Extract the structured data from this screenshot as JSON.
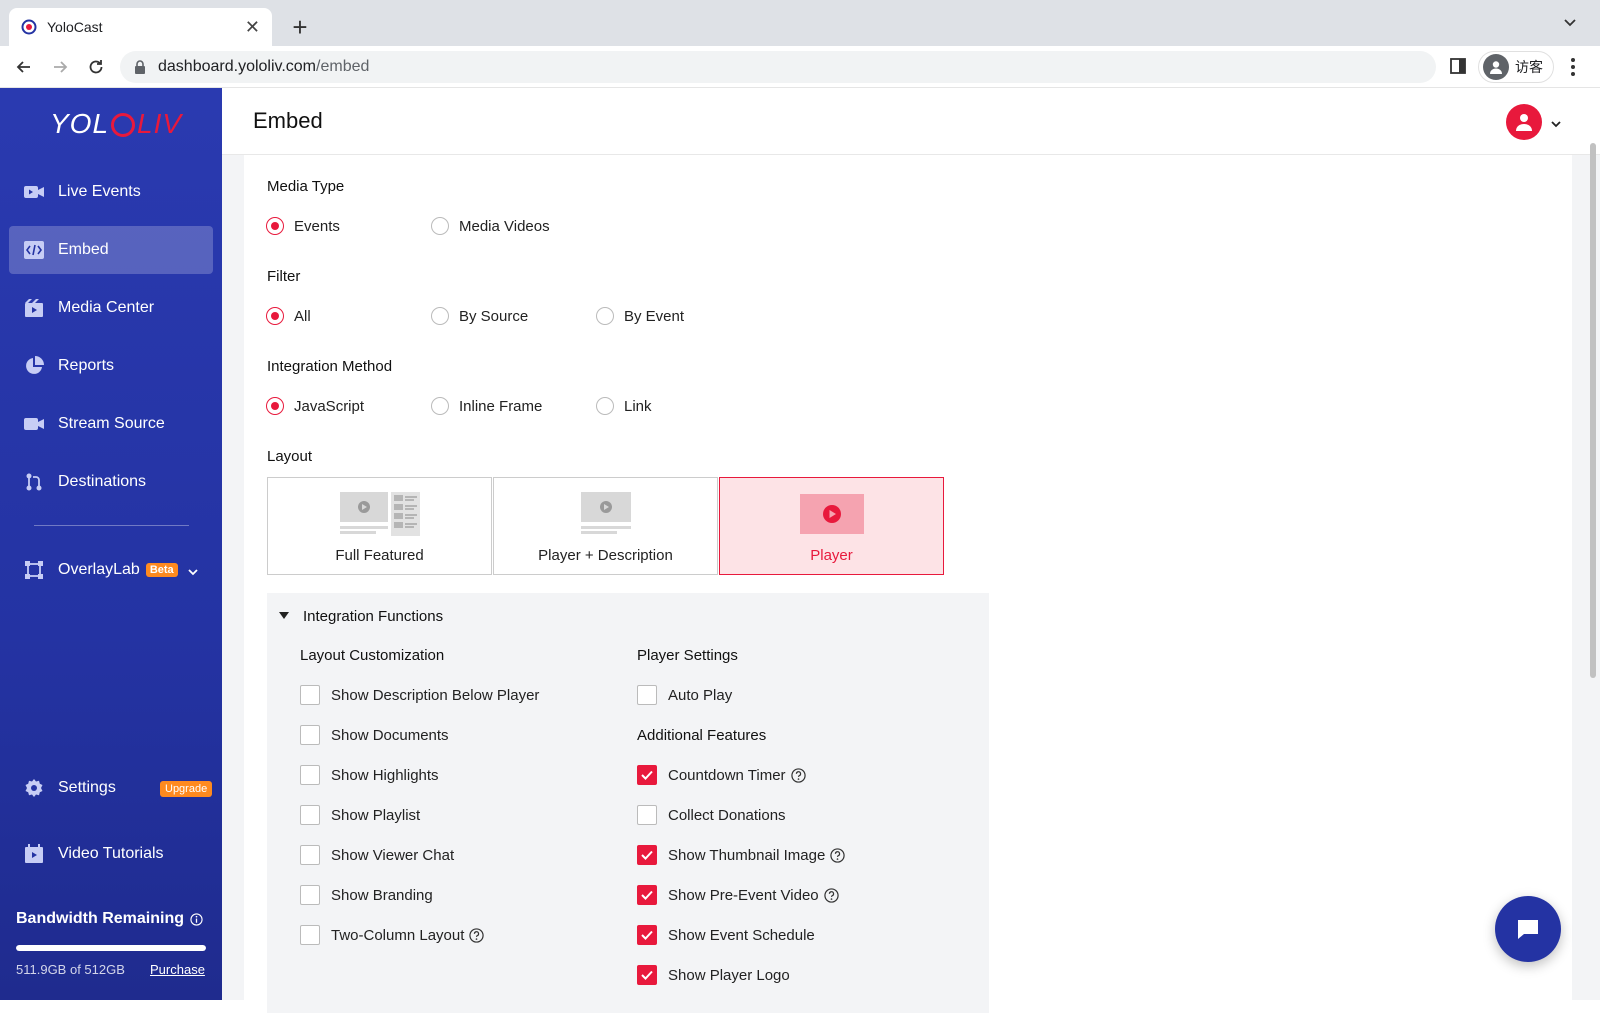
{
  "browser": {
    "tab_title": "YoloCast",
    "url_host": "dashboard.yololiv.com",
    "url_path": "/embed",
    "profile_label": "访客"
  },
  "sidebar": {
    "logo_left": "YOL",
    "logo_right": "LIV",
    "items": [
      {
        "label": "Live Events",
        "icon": "video-camera-icon"
      },
      {
        "label": "Embed",
        "icon": "code-icon"
      },
      {
        "label": "Media Center",
        "icon": "film-icon"
      },
      {
        "label": "Reports",
        "icon": "pie-chart-icon"
      },
      {
        "label": "Stream Source",
        "icon": "camera-icon"
      },
      {
        "label": "Destinations",
        "icon": "branch-icon"
      },
      {
        "label": "OverlayLab",
        "icon": "overlay-icon",
        "badge": "Beta"
      }
    ],
    "settings_label": "Settings",
    "upgrade_badge": "Upgrade",
    "tutorials_label": "Video Tutorials",
    "bandwidth": {
      "title": "Bandwidth Remaining",
      "usage_text": "511.9GB of 512GB",
      "fraction_remaining": 0.9998,
      "purchase_label": "Purchase"
    }
  },
  "header": {
    "title": "Embed"
  },
  "media_type": {
    "label": "Media Type",
    "options": [
      "Events",
      "Media Videos"
    ],
    "selected": "Events"
  },
  "filter": {
    "label": "Filter",
    "options": [
      "All",
      "By Source",
      "By Event"
    ],
    "selected": "All"
  },
  "integration_method": {
    "label": "Integration Method",
    "options": [
      "JavaScript",
      "Inline Frame",
      "Link"
    ],
    "selected": "JavaScript"
  },
  "layout": {
    "label": "Layout",
    "options": [
      "Full Featured",
      "Player + Description",
      "Player"
    ],
    "selected": "Player"
  },
  "integration_functions": {
    "title": "Integration Functions",
    "layout_customization": {
      "title": "Layout Customization",
      "items": [
        {
          "label": "Show Description Below Player",
          "checked": false
        },
        {
          "label": "Show Documents",
          "checked": false
        },
        {
          "label": "Show Highlights",
          "checked": false
        },
        {
          "label": "Show Playlist",
          "checked": false
        },
        {
          "label": "Show Viewer Chat",
          "checked": false
        },
        {
          "label": "Show Branding",
          "checked": false
        },
        {
          "label": "Two-Column Layout",
          "checked": false,
          "help": true
        }
      ]
    },
    "player_settings": {
      "title": "Player Settings",
      "items": [
        {
          "label": "Auto Play",
          "checked": false
        }
      ]
    },
    "additional_features": {
      "title": "Additional Features",
      "items": [
        {
          "label": "Countdown Timer",
          "checked": true,
          "help": true
        },
        {
          "label": "Collect Donations",
          "checked": false
        },
        {
          "label": "Show Thumbnail Image",
          "checked": true,
          "help": true
        },
        {
          "label": "Show Pre-Event Video",
          "checked": true,
          "help": true
        },
        {
          "label": "Show Event Schedule",
          "checked": true
        },
        {
          "label": "Show Player Logo",
          "checked": true
        }
      ]
    }
  },
  "colors": {
    "accent": "#e8193c",
    "sidebar": "#2433a3",
    "badge": "#ff8a1f"
  }
}
